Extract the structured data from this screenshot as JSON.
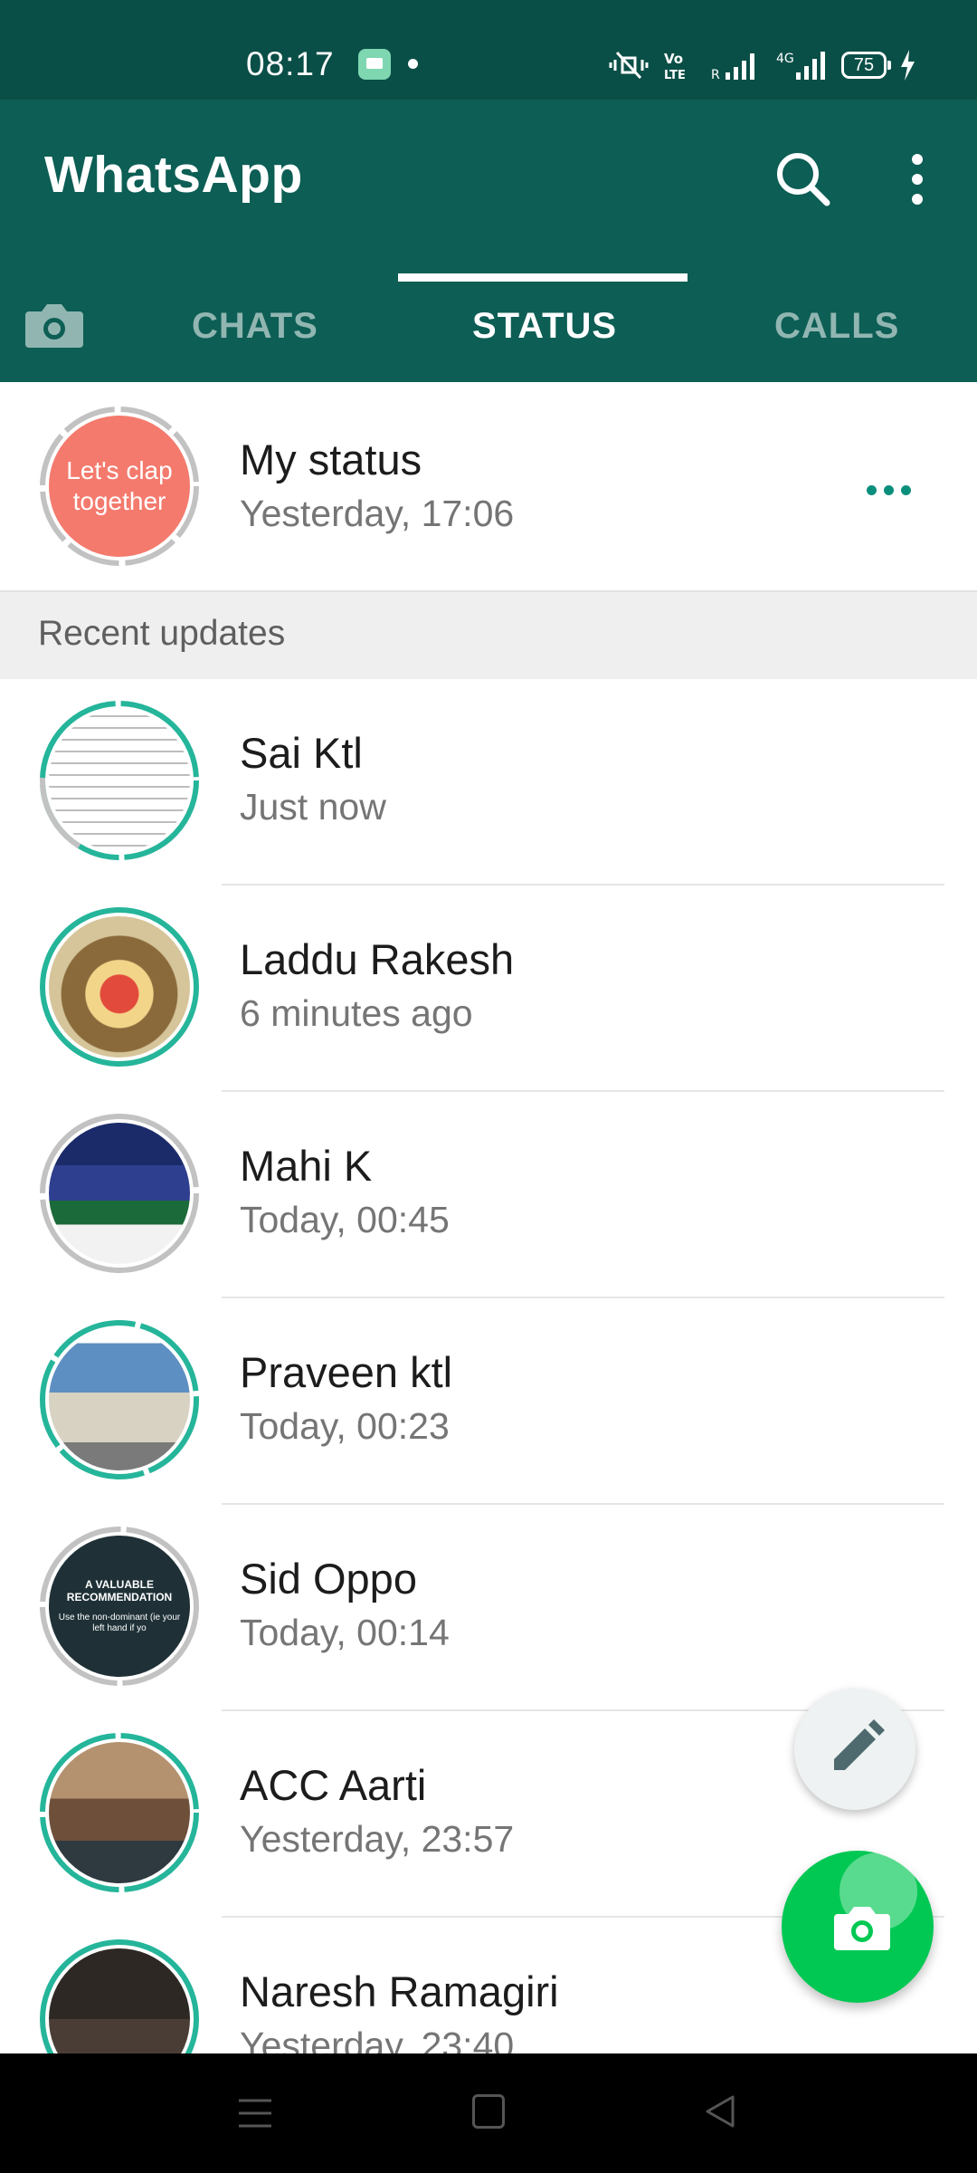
{
  "status_bar": {
    "time": "08:17",
    "battery": "75"
  },
  "app_bar": {
    "title": "WhatsApp",
    "tabs": [
      "CHATS",
      "STATUS",
      "CALLS"
    ],
    "active_tab": "STATUS"
  },
  "my_status": {
    "avatar_text": "Let's clap together",
    "name": "My status",
    "time": "Yesterday, 17:06"
  },
  "section_label": "Recent updates",
  "updates": [
    {
      "name": "Sai Ktl",
      "time": "Just now",
      "seen": false
    },
    {
      "name": "Laddu Rakesh",
      "time": "6 minutes ago",
      "seen": false
    },
    {
      "name": "Mahi K",
      "time": "Today, 00:45",
      "seen": true
    },
    {
      "name": "Praveen ktl",
      "time": "Today, 00:23",
      "seen": false
    },
    {
      "name": "Sid Oppo",
      "time": "Today, 00:14",
      "seen": true,
      "thumb_title": "A VALUABLE RECOMMENDATION",
      "thumb_body": "Use the non-dominant (ie your left hand if yo"
    },
    {
      "name": "ACC Aarti",
      "time": "Yesterday, 23:57",
      "seen": false
    },
    {
      "name": "Naresh Ramagiri",
      "time": "Yesterday, 23:40",
      "seen": false
    }
  ],
  "colors": {
    "status_bar": "#0a4f47",
    "app_bar": "#0d5e55",
    "unseen_ring": "#25b59a",
    "seen_ring": "#bdbdbd",
    "fab_green": "#00c853"
  },
  "icons": [
    "search-icon",
    "more-vert-icon",
    "camera-icon",
    "pencil-icon",
    "menu-icon",
    "home-icon",
    "back-icon"
  ]
}
